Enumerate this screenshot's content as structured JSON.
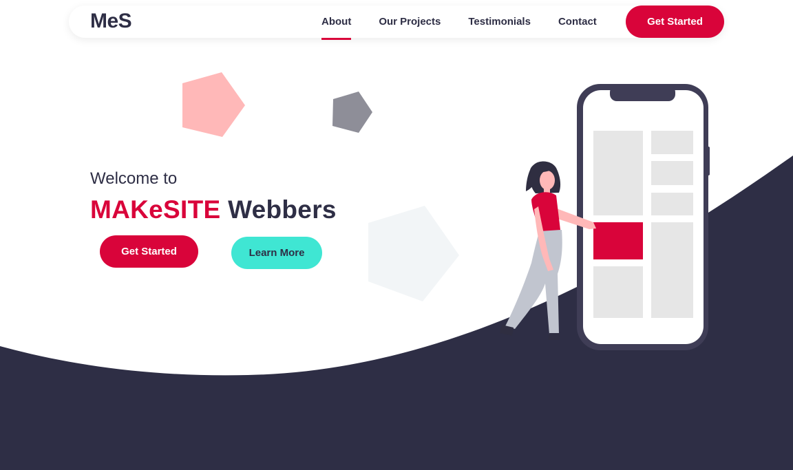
{
  "navbar": {
    "logo": "MeS",
    "links": [
      {
        "label": "About",
        "active": true
      },
      {
        "label": "Our Projects",
        "active": false
      },
      {
        "label": "Testimonials",
        "active": false
      },
      {
        "label": "Contact",
        "active": false
      }
    ],
    "cta_label": "Get Started"
  },
  "hero": {
    "welcome": "Welcome to",
    "title_brand": "MAKeSITE",
    "title_rest": "Webbers",
    "primary_button": "Get Started",
    "secondary_button": "Learn More"
  },
  "colors": {
    "accent": "#d9043a",
    "dark": "#2e2e45",
    "teal": "#3fe6d3",
    "pink_pentagon": "#ffb8b8",
    "gray_pentagon": "#8e8e98"
  },
  "icons": [
    "pentagon-pink-decor",
    "pentagon-gray-decor",
    "pentagon-pale-decor",
    "phone-illustration",
    "woman-figure-illustration"
  ]
}
